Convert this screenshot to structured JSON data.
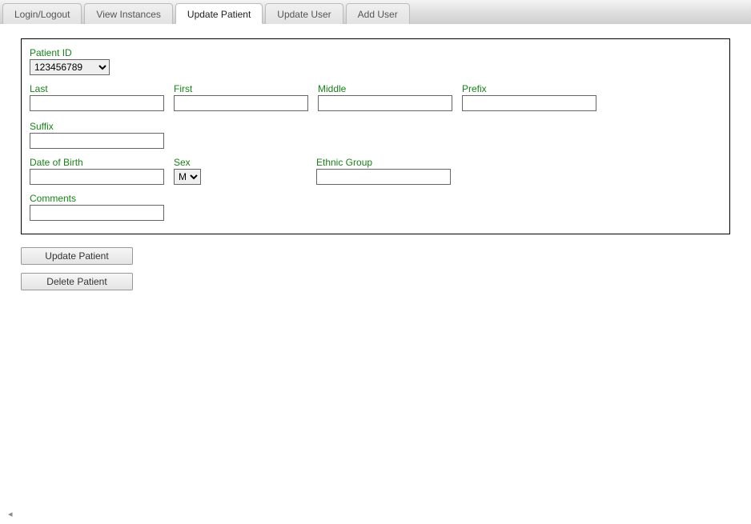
{
  "tabs": {
    "login": "Login/Logout",
    "view": "View Instances",
    "updatePatient": "Update Patient",
    "updateUser": "Update User",
    "addUser": "Add User"
  },
  "form": {
    "patientId": {
      "label": "Patient ID",
      "value": "123456789"
    },
    "last": {
      "label": "Last",
      "value": ""
    },
    "first": {
      "label": "First",
      "value": ""
    },
    "middle": {
      "label": "Middle",
      "value": ""
    },
    "prefix": {
      "label": "Prefix",
      "value": ""
    },
    "suffix": {
      "label": "Suffix",
      "value": ""
    },
    "dob": {
      "label": "Date of Birth",
      "value": ""
    },
    "sex": {
      "label": "Sex",
      "value": "M"
    },
    "ethnic": {
      "label": "Ethnic Group",
      "value": ""
    },
    "comments": {
      "label": "Comments",
      "value": ""
    }
  },
  "buttons": {
    "update": "Update Patient",
    "delete": "Delete Patient"
  },
  "cornerGlyph": "◂"
}
